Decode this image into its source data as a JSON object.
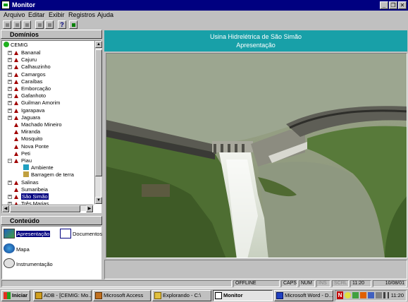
{
  "window": {
    "title": "Monitor"
  },
  "menu": [
    "Arquivo",
    "Editar",
    "Exibir",
    "Registros",
    "Ajuda"
  ],
  "toolbar": [
    "cut-icon",
    "copy-icon",
    "paste-icon",
    "open-icon",
    "save-icon",
    "help-icon",
    "exit-icon"
  ],
  "domains": {
    "header": "Domínios",
    "root": "CEMIG",
    "items": [
      {
        "label": "Bananal",
        "expandable": true
      },
      {
        "label": "Cajuru",
        "expandable": true
      },
      {
        "label": "Calhauzinho",
        "expandable": true
      },
      {
        "label": "Camargos",
        "expandable": true
      },
      {
        "label": "Caraíbas",
        "expandable": true
      },
      {
        "label": "Emborcação",
        "expandable": true
      },
      {
        "label": "Gafanhoto",
        "expandable": true
      },
      {
        "label": "Guilman Amorim",
        "expandable": true
      },
      {
        "label": "Igarapava",
        "expandable": true
      },
      {
        "label": "Jaguara",
        "expandable": true
      },
      {
        "label": "Machado Mineiro",
        "expandable": false
      },
      {
        "label": "Miranda",
        "expandable": false
      },
      {
        "label": "Mosquito",
        "expandable": false
      },
      {
        "label": "Nova Ponte",
        "expandable": false
      },
      {
        "label": "Peti",
        "expandable": false
      },
      {
        "label": "Piau",
        "expandable": true,
        "expanded": true
      },
      {
        "label": "Ambiente",
        "child": true,
        "icon": "environment-icon"
      },
      {
        "label": "Barragem de terra",
        "child": true,
        "icon": "dam-icon"
      },
      {
        "label": "Salinas",
        "expandable": true
      },
      {
        "label": "Sumaribeia",
        "expandable": false
      },
      {
        "label": "São Simão",
        "expandable": true,
        "selected": true
      },
      {
        "label": "Três Marias",
        "expandable": true
      }
    ]
  },
  "contents": {
    "header": "Conteúdo",
    "items": [
      {
        "label": "Apresentação",
        "icon": "presentation-icon",
        "selected": true
      },
      {
        "label": "Documentos",
        "icon": "documents-icon"
      },
      {
        "label": "Mapa",
        "icon": "map-icon"
      },
      {
        "label": "Instrumentação",
        "icon": "instrumentation-icon"
      }
    ]
  },
  "main": {
    "title": "Usina Hidrelétrica de São Simão",
    "subtitle": "Apresentação"
  },
  "status": [
    "OFFLINE",
    "CAPS",
    "NUM",
    "INS",
    "SCRL",
    "11:20",
    "10/08/01"
  ],
  "taskbar": {
    "start": "Iniciar",
    "tasks": [
      {
        "label": "ADB - [CEMIG: Mo...",
        "icon": "database-icon"
      },
      {
        "label": "Microsoft Access",
        "icon": "access-icon"
      },
      {
        "label": "Explorando - C:\\",
        "icon": "explorer-icon"
      },
      {
        "label": "Monitor",
        "icon": "monitor-icon",
        "active": true
      },
      {
        "label": "Microsoft Word - D...",
        "icon": "word-icon"
      }
    ],
    "clock": "11:20"
  },
  "colors": {
    "titlebar": "#000080",
    "header": "#18a0a8",
    "tree_marker": "#a00000"
  }
}
